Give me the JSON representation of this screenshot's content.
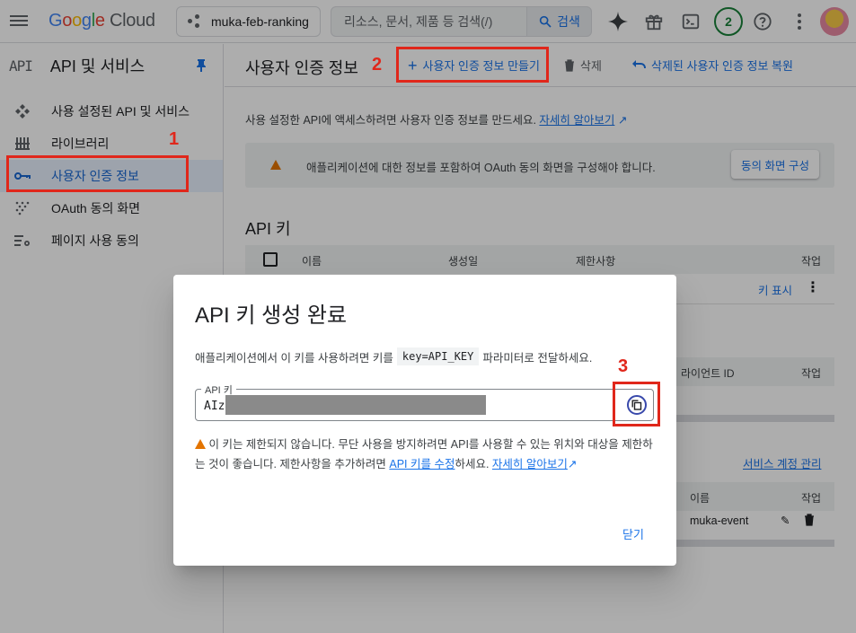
{
  "topbar": {
    "logo_google": "Google",
    "logo_cloud": "Cloud",
    "project_name": "muka-feb-ranking",
    "search_placeholder": "리소스, 문서, 제품 등 검색(/)",
    "search_button": "검색",
    "notification_count": "2"
  },
  "sidebar": {
    "header_icon": "API",
    "title": "API 및 서비스",
    "items": [
      {
        "label": "사용 설정된 API 및 서비스",
        "icon": "enabled-apis-icon"
      },
      {
        "label": "라이브러리",
        "icon": "library-icon"
      },
      {
        "label": "사용자 인증 정보",
        "icon": "key-icon",
        "active": true
      },
      {
        "label": "OAuth 동의 화면",
        "icon": "oauth-consent-icon"
      },
      {
        "label": "페이지 사용 동의",
        "icon": "page-usage-icon"
      }
    ]
  },
  "main": {
    "title": "사용자 인증 정보",
    "create_button": "사용자 인증 정보 만들기",
    "delete_button": "삭제",
    "restore_button": "삭제된 사용자 인증 정보 복원",
    "description": "사용 설정한 API에 액세스하려면 사용자 인증 정보를 만드세요.",
    "learn_more": "자세히 알아보기",
    "warning_text": "애플리케이션에 대한 정보를 포함하여 OAuth 동의 화면을 구성해야 합니다.",
    "configure_button": "동의 화면 구성",
    "api_keys_section": "API 키",
    "api_keys_columns": [
      "이름",
      "생성일",
      "제한사항",
      "작업"
    ],
    "show_key_link": "키 표시",
    "oauth_column_partial": "라이언트 ID",
    "actions_label": "작업",
    "manage_service_accounts": "서비스 계정 관리",
    "service_column_partial": "이름",
    "service_row_partial": "muka-event"
  },
  "dialog": {
    "title": "API 키 생성 완료",
    "text_before": "애플리케이션에서 이 키를 사용하려면 키를",
    "code": "key=API_KEY",
    "text_after": "파라미터로 전달하세요.",
    "key_label": "API 키",
    "key_prefix": "AIz",
    "warning_part1": "이 키는 제한되지 않습니다. 무단 사용을 방지하려면 API를 사용할 수 있는 위치와 대상을 제한하는 것이 좋습니다. 제한사항을 추가하려면",
    "edit_key_link": "API 키를 수정",
    "warning_part2": "하세요.",
    "learn_more": "자세히 알아보기",
    "close_button": "닫기"
  },
  "annotations": {
    "step1": "1",
    "step2": "2",
    "step3": "3",
    "color": "#e0271b"
  }
}
